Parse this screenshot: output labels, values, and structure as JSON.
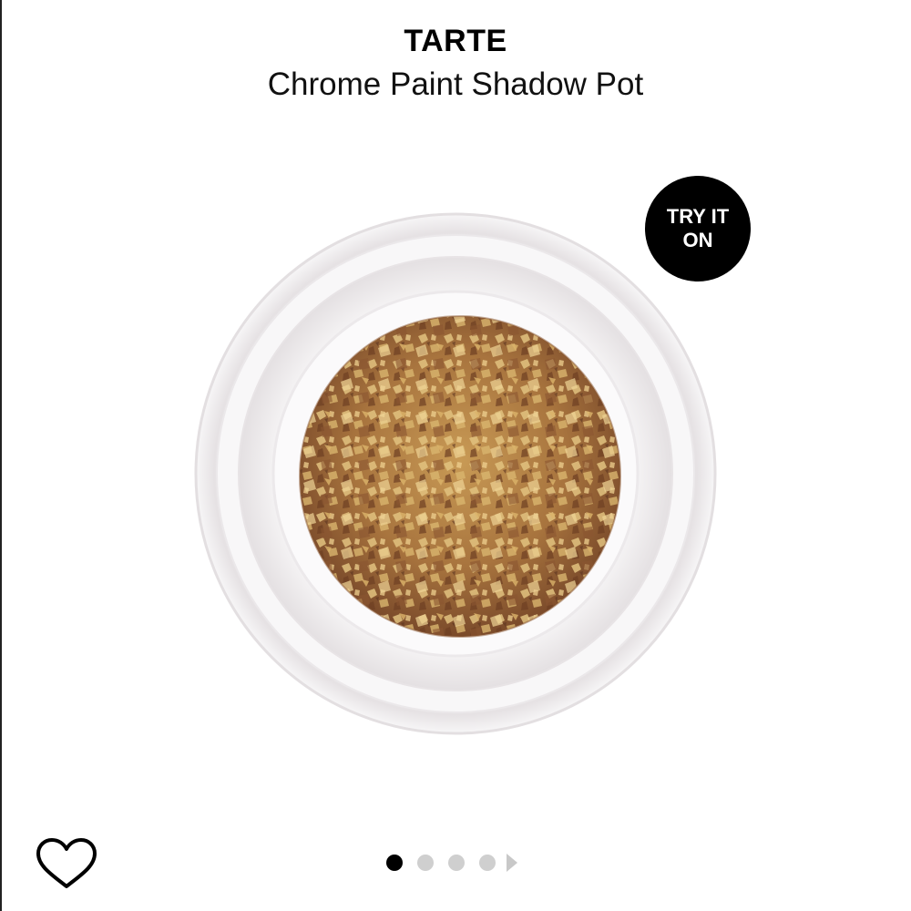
{
  "product": {
    "brand": "TARTE",
    "name": "Chrome Paint Shadow Pot"
  },
  "try_on": {
    "label": "TRY IT ON"
  },
  "icons": {
    "wishlist": "heart-icon",
    "next": "chevron-right-icon"
  },
  "carousel": {
    "total_images": 4,
    "active_index": 0
  },
  "colors": {
    "try_on_background": "#000000",
    "dot_active": "#000000",
    "dot_inactive": "#cfcfcf",
    "shadow_gold": "#c9a05a",
    "shadow_bronze": "#7a4a2a"
  }
}
